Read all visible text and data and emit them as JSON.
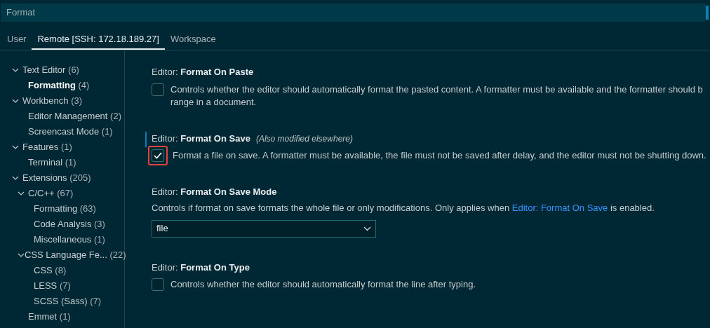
{
  "search": {
    "value": "Format"
  },
  "tabs": [
    {
      "label": "User",
      "selected": false
    },
    {
      "label": "Remote [SSH: 172.18.189.27]",
      "selected": true
    },
    {
      "label": "Workspace",
      "selected": false
    }
  ],
  "tree": [
    {
      "label": "Text Editor",
      "count": "(6)",
      "expanded": true,
      "selected": false,
      "children": [
        {
          "label": "Formatting",
          "count": "(4)",
          "selected": true
        }
      ]
    },
    {
      "label": "Workbench",
      "count": "(3)",
      "expanded": true,
      "selected": false,
      "children": [
        {
          "label": "Editor Management",
          "count": "(2)",
          "selected": false
        },
        {
          "label": "Screencast Mode",
          "count": "(1)",
          "selected": false
        }
      ]
    },
    {
      "label": "Features",
      "count": "(1)",
      "expanded": true,
      "selected": false,
      "children": [
        {
          "label": "Terminal",
          "count": "(1)",
          "selected": false
        }
      ]
    },
    {
      "label": "Extensions",
      "count": "(205)",
      "expanded": true,
      "selected": false,
      "children": [
        {
          "label": "C/C++",
          "count": "(67)",
          "expanded": true,
          "selected": false,
          "children": [
            {
              "label": "Formatting",
              "count": "(63)",
              "selected": false
            },
            {
              "label": "Code Analysis",
              "count": "(3)",
              "selected": false
            },
            {
              "label": "Miscellaneous",
              "count": "(1)",
              "selected": false
            }
          ]
        },
        {
          "label": "CSS Language Fe...",
          "count": "(22)",
          "expanded": true,
          "selected": false,
          "children": [
            {
              "label": "CSS",
              "count": "(8)",
              "selected": false
            },
            {
              "label": "LESS",
              "count": "(7)",
              "selected": false
            },
            {
              "label": "SCSS (Sass)",
              "count": "(7)",
              "selected": false
            }
          ]
        },
        {
          "label": "Emmet",
          "count": "(1)",
          "selected": false
        }
      ]
    }
  ],
  "settings": [
    {
      "kind": "checkbox",
      "category": "Editor:",
      "name": "Format On Paste",
      "checked": false,
      "description": [
        "Controls whether the editor should automatically format the pasted content. A formatter must be available and the formatter should b",
        "range in a document."
      ]
    },
    {
      "kind": "checkbox",
      "category": "Editor:",
      "name": "Format On Save",
      "note": "(Also modified elsewhere)",
      "modified": true,
      "annotated": true,
      "checked": true,
      "description": [
        "Format a file on save. A formatter must be available, the file must not be saved after delay, and the editor must not be shutting down."
      ]
    },
    {
      "kind": "dropdown",
      "category": "Editor:",
      "name": "Format On Save Mode",
      "description_before": "Controls if format on save formats the whole file or only modifications. Only applies when ",
      "description_link": "Editor: Format On Save",
      "description_after": " is enabled.",
      "value": "file"
    },
    {
      "kind": "checkbox",
      "category": "Editor:",
      "name": "Format On Type",
      "checked": false,
      "description": [
        "Controls whether the editor should automatically format the line after typing."
      ]
    }
  ]
}
